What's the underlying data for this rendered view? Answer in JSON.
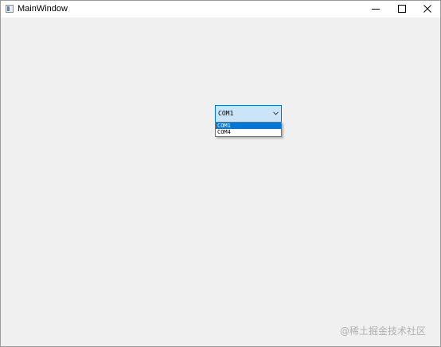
{
  "window": {
    "title": "MainWindow",
    "controls": {
      "minimize_icon": "minimize-icon",
      "maximize_icon": "maximize-icon",
      "close_icon": "close-icon"
    }
  },
  "combobox": {
    "selected_value": "COM1",
    "options": [
      "COM1",
      "COM4"
    ],
    "highlighted_index": 0
  },
  "watermark": {
    "text": "@稀土掘金技术社区"
  },
  "colors": {
    "accent": "#0078d7",
    "combo_background": "#cce4f7",
    "window_background": "#f0f0f0",
    "titlebar_background": "#ffffff"
  }
}
